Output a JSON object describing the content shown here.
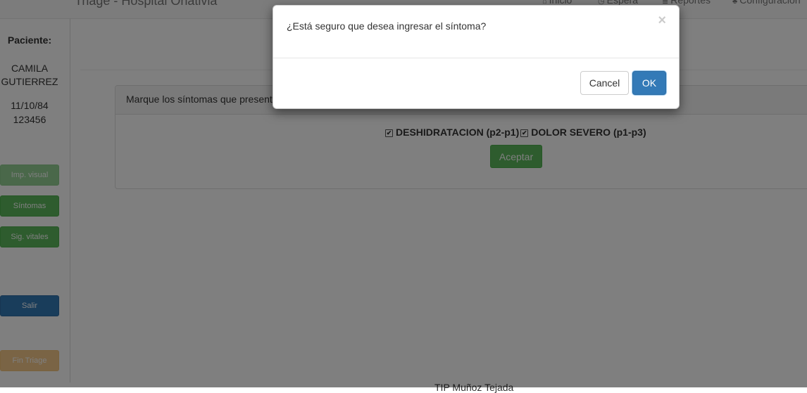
{
  "navbar": {
    "brand": "Triage - Hospital Oñativia",
    "items": [
      {
        "icon": "home-icon",
        "glyph": "⌂",
        "label": "Inicio"
      },
      {
        "icon": "clock-icon",
        "glyph": "◷",
        "label": "Espera"
      },
      {
        "icon": "list-icon",
        "glyph": "≣",
        "label": "Reportes"
      },
      {
        "icon": "wrench-icon",
        "glyph": "♣",
        "label": "Configuración"
      }
    ]
  },
  "sidebar": {
    "patient_label": "Paciente:",
    "patient_name_first": "CAMILA",
    "patient_name_last": "GUTIERREZ",
    "dob": "11/10/84",
    "id": "123456",
    "buttons": {
      "imp_visual": "Imp. visual",
      "sintomas": "Síntomas",
      "sig_vitales": "Sig. vitales",
      "salir": "Salir",
      "fin_triage": "Fin Triage"
    }
  },
  "panel": {
    "heading": "Marque los síntomas que presenta el paciente",
    "symptoms": [
      {
        "label": "DESHIDRATACION (p2-p1)",
        "checked": true
      },
      {
        "label": "DOLOR SEVERO (p1-p3)",
        "checked": true
      }
    ],
    "accept_label": "Aceptar"
  },
  "footer": {
    "text": "TIP Muñoz Tejada"
  },
  "modal": {
    "message": "¿Está seguro que desea ingresar el síntoma?",
    "close_glyph": "×",
    "cancel_label": "Cancel",
    "ok_label": "OK"
  },
  "colors": {
    "success": "#5cb85c",
    "primary": "#337ab7",
    "warning": "#f0ad4e",
    "backdrop": "#000000"
  }
}
